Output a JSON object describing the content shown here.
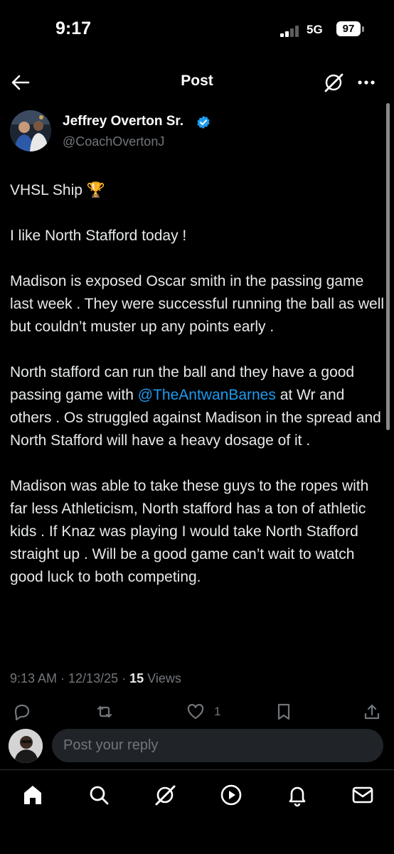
{
  "status_bar": {
    "time": "9:17",
    "network": "5G",
    "battery": "97"
  },
  "header": {
    "title": "Post",
    "back_icon": "arrow-left-icon",
    "grok_icon": "grok-icon",
    "more_icon": "more-horizontal-icon"
  },
  "post": {
    "author_name": "Jeffrey Overton Sr.",
    "author_handle": "@CoachOvertonJ",
    "verified": true,
    "paragraphs": {
      "p1": "VHSL Ship 🏆",
      "p2": "I like North Stafford today !",
      "p3": "Madison is exposed Oscar smith in the passing game last week . They were successful running the ball as well but couldn’t muster up any points early .",
      "p4_before": "North stafford can run the ball and they have a good passing game with ",
      "p4_mention": "@TheAntwanBarnes",
      "p4_after": " at Wr and others . Os struggled against Madison in the spread and North Stafford will have a heavy dosage of it .",
      "p5": "Madison was able to take these guys to the ropes with far less Athleticism, North stafford has a ton of athletic kids . If Knaz was playing I would take North Stafford straight up . Will be a good game can’t wait to watch good luck to both competing."
    },
    "timestamp": "9:13 AM · 12/13/25 · ",
    "views_count": "15",
    "views_label": " Views",
    "like_count": "1"
  },
  "reply": {
    "placeholder": "Post your reply"
  },
  "tab_bar": {
    "items": [
      "home-icon",
      "search-icon",
      "grok-icon",
      "play-icon",
      "notifications-icon",
      "messages-icon"
    ]
  },
  "colors": {
    "background": "#000000",
    "text": "#e7e9ea",
    "secondary": "#71767b",
    "link": "#1d9bf0",
    "verified": "#1d9bf0"
  }
}
